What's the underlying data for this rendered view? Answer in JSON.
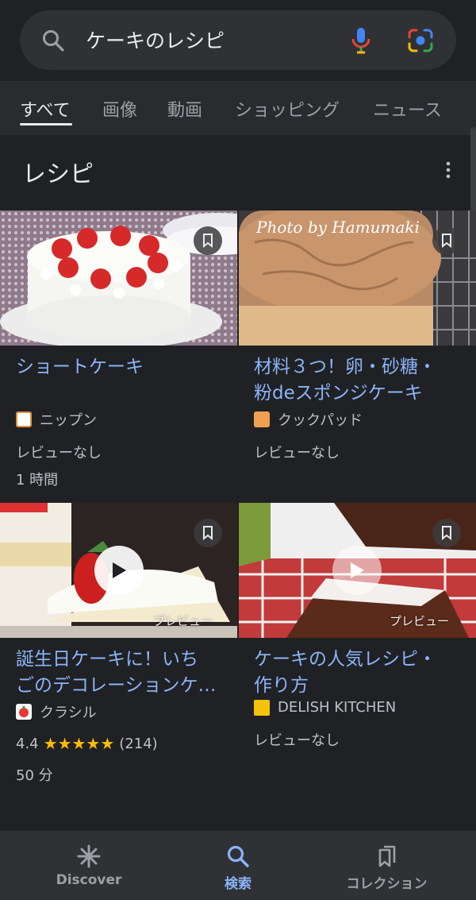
{
  "search": {
    "query": "ケーキのレシピ"
  },
  "tabs": [
    {
      "label": "すべて",
      "active": true
    },
    {
      "label": "画像"
    },
    {
      "label": "動画"
    },
    {
      "label": "ショッピング"
    },
    {
      "label": "ニュース"
    }
  ],
  "section": {
    "title": "レシピ"
  },
  "cards": [
    {
      "title": "ショートケーキ",
      "source": "ニップン",
      "reviews": "レビューなし",
      "time": "1 時間"
    },
    {
      "title_line1": "材料３つ！卵・砂糖・",
      "title_line2": "粉deスポンジケーキ",
      "source": "クックパッド",
      "reviews": "レビューなし",
      "image_text": "Photo by Hamumaki"
    },
    {
      "title_line1": "誕生日ケーキに！いち",
      "title_line2": "ごのデコレーションケ…",
      "source": "クラシル",
      "rating": "4.4",
      "stars": "★★★★★",
      "review_count": "(214)",
      "time": "50 分",
      "preview": "プレビュー"
    },
    {
      "title_line1": "ケーキの人気レシピ・",
      "title_line2": "作り方",
      "source": "DELISH KITCHEN",
      "reviews": "レビューなし",
      "preview": "プレビュー"
    }
  ],
  "bottom_nav": [
    {
      "label": "Discover",
      "icon": "discover-asterisk-icon"
    },
    {
      "label": "検索",
      "icon": "search-icon",
      "active": true
    },
    {
      "label": "コレクション",
      "icon": "collections-icon"
    }
  ],
  "colors": {
    "background": "#202124",
    "link": "#8ab4f8",
    "star": "#fbbc04"
  }
}
